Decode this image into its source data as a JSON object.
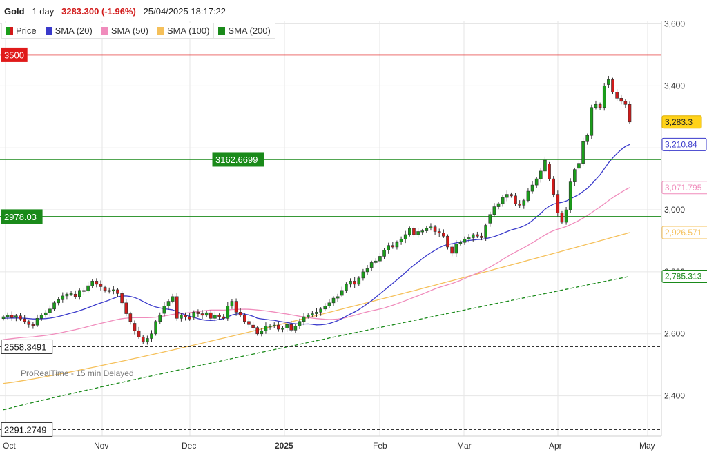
{
  "header": {
    "instrument": "Gold",
    "period": "1 day",
    "last": "3283.300",
    "change": "(-1.96%)",
    "datetime": "25/04/2025 18:17:22"
  },
  "legend": [
    {
      "label": "Price",
      "color": "price"
    },
    {
      "label": "SMA (20)",
      "color": "#3a3acb"
    },
    {
      "label": "SMA (50)",
      "color": "#f08cbc"
    },
    {
      "label": "SMA (100)",
      "color": "#f5c05a"
    },
    {
      "label": "SMA (200)",
      "color": "#1a8a1a"
    }
  ],
  "watermark": "ProRealTime - 15 min Delayed",
  "chart_data": {
    "type": "candlestick",
    "y_axis": {
      "ticks": [
        2400,
        2600,
        2800,
        3000,
        3200,
        3400,
        3600
      ],
      "tick_labels": [
        "2,400",
        "2,600",
        "2,800",
        "3,000",
        "3,200",
        "3,400",
        "3,600"
      ],
      "range": [
        2270,
        3610
      ]
    },
    "x_axis": {
      "labels": [
        "Oct",
        "Nov",
        "Dec",
        "2025",
        "Feb",
        "Mar",
        "Apr",
        "May"
      ],
      "range": [
        "2024-10-01",
        "2025-05-06"
      ]
    },
    "horizontal_lines": [
      {
        "value": 3500,
        "label": "3500",
        "color": "#e01a1a",
        "style": "solid"
      },
      {
        "value": 3162.6699,
        "label": "3162.6699",
        "color": "#1a8a1a",
        "style": "solid"
      },
      {
        "value": 2978.03,
        "label": "2978.03",
        "color": "#1a8a1a",
        "style": "solid"
      },
      {
        "value": 2558.3491,
        "label": "2558.3491",
        "color": "#333333",
        "style": "dashed"
      },
      {
        "value": 2291.2749,
        "label": "2291.2749",
        "color": "#333333",
        "style": "dashed"
      }
    ],
    "price_tags": [
      {
        "value": 3283.3,
        "label": "3,283.3",
        "bg": "#ffd21a",
        "fg": "#222222",
        "border": "#e0b000"
      },
      {
        "value": 3210.84,
        "label": "3,210.84",
        "bg": "#ffffff",
        "fg": "#3a3acb",
        "border": "#3a3acb"
      },
      {
        "value": 3071.795,
        "label": "3,071.795",
        "bg": "#ffffff",
        "fg": "#f08cbc",
        "border": "#f08cbc"
      },
      {
        "value": 2926.571,
        "label": "2,926.571",
        "bg": "#ffffff",
        "fg": "#f5c05a",
        "border": "#f5c05a"
      },
      {
        "value": 2785.313,
        "label": "2,785.313",
        "bg": "#ffffff",
        "fg": "#1a8a1a",
        "border": "#1a8a1a"
      }
    ],
    "candles_close": [
      2655,
      2660,
      2652,
      2658,
      2648,
      2640,
      2630,
      2628,
      2650,
      2660,
      2668,
      2680,
      2700,
      2710,
      2722,
      2728,
      2730,
      2720,
      2740,
      2738,
      2755,
      2770,
      2760,
      2752,
      2740,
      2738,
      2742,
      2730,
      2700,
      2665,
      2640,
      2610,
      2590,
      2575,
      2585,
      2600,
      2640,
      2660,
      2690,
      2705,
      2720,
      2650,
      2660,
      2655,
      2648,
      2670,
      2665,
      2660,
      2668,
      2650,
      2660,
      2656,
      2650,
      2690,
      2705,
      2670,
      2660,
      2640,
      2630,
      2620,
      2600,
      2610,
      2625,
      2625,
      2628,
      2615,
      2618,
      2630,
      2612,
      2625,
      2640,
      2655,
      2660,
      2665,
      2670,
      2680,
      2690,
      2700,
      2715,
      2720,
      2740,
      2760,
      2770,
      2760,
      2780,
      2800,
      2810,
      2830,
      2835,
      2850,
      2870,
      2885,
      2880,
      2895,
      2905,
      2920,
      2940,
      2920,
      2930,
      2932,
      2940,
      2945,
      2930,
      2925,
      2915,
      2880,
      2860,
      2890,
      2895,
      2905,
      2910,
      2920,
      2915,
      2910,
      2950,
      2985,
      3010,
      3020,
      3040,
      3050,
      3045,
      3020,
      3015,
      3030,
      3060,
      3080,
      3100,
      3125,
      3160,
      3100,
      3050,
      2990,
      2960,
      3000,
      3090,
      3130,
      3150,
      3220,
      3240,
      3330,
      3340,
      3330,
      3400,
      3420,
      3380,
      3360,
      3350,
      3340,
      3283.3
    ],
    "series": [
      {
        "name": "SMA (20)",
        "color": "#3a3acb",
        "style": "solid",
        "last": 3210.84
      },
      {
        "name": "SMA (50)",
        "color": "#f08cbc",
        "style": "solid",
        "last": 3071.795
      },
      {
        "name": "SMA (100)",
        "color": "#f5c05a",
        "style": "solid",
        "last": 2926.571
      },
      {
        "name": "SMA (200)",
        "color": "#1a8a1a",
        "style": "dashed",
        "last": 2785.313
      }
    ]
  }
}
